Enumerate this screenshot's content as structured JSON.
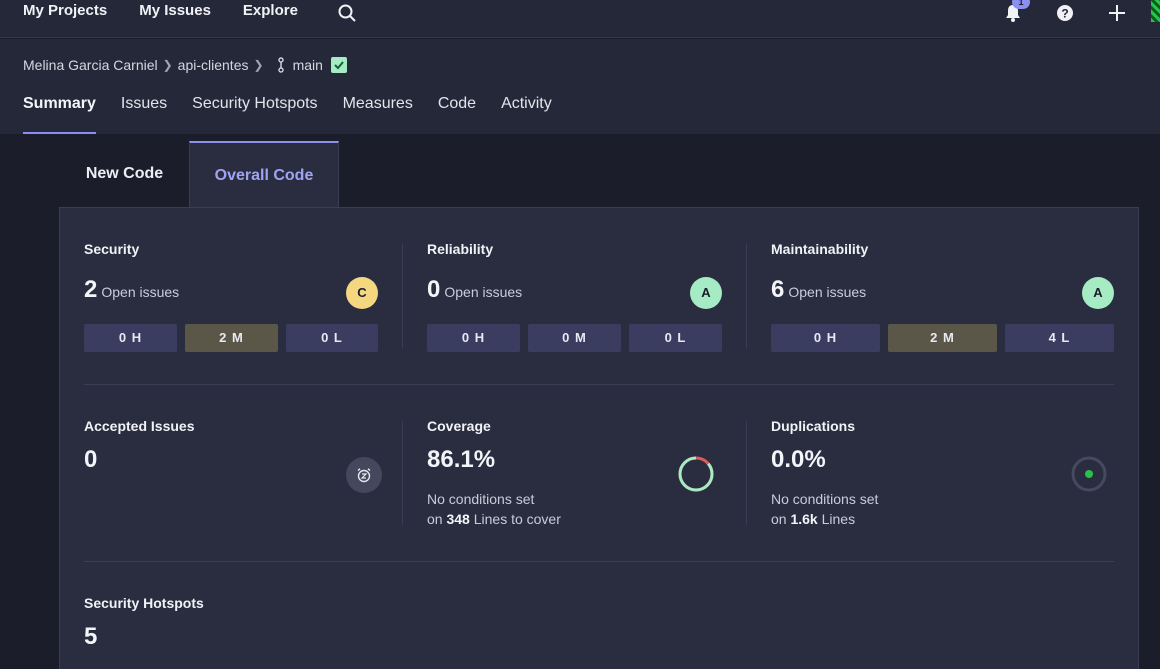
{
  "topnav": {
    "my_projects": "My Projects",
    "my_issues": "My Issues",
    "explore": "Explore",
    "notification_count": "1"
  },
  "breadcrumb": {
    "owner": "Melina Garcia Carniel",
    "project": "api-clientes",
    "branch": "main"
  },
  "tabs": [
    "Summary",
    "Issues",
    "Security Hotspots",
    "Measures",
    "Code",
    "Activity"
  ],
  "code_tabs": {
    "new_code": "New Code",
    "overall_code": "Overall Code"
  },
  "security": {
    "title": "Security",
    "count": "2",
    "open_label": "Open issues",
    "grade": "C",
    "high": "0 H",
    "medium": "2 M",
    "low": "0 L"
  },
  "reliability": {
    "title": "Reliability",
    "count": "0",
    "open_label": "Open issues",
    "grade": "A",
    "high": "0 H",
    "medium": "0 M",
    "low": "0 L"
  },
  "maintainability": {
    "title": "Maintainability",
    "count": "6",
    "open_label": "Open issues",
    "grade": "A",
    "high": "0 H",
    "medium": "2 M",
    "low": "4 L"
  },
  "accepted": {
    "title": "Accepted Issues",
    "value": "0"
  },
  "coverage": {
    "title": "Coverage",
    "value": "86.1%",
    "note": "No conditions set",
    "on": "on",
    "lines": "348",
    "lines_label": "Lines to cover",
    "percent": 86.1
  },
  "duplications": {
    "title": "Duplications",
    "value": "0.0%",
    "note": "No conditions set",
    "on": "on",
    "lines": "1.6k",
    "lines_label": "Lines"
  },
  "hotspots": {
    "title": "Security Hotspots",
    "value": "5"
  },
  "colors": {
    "grade_a": "#a5ecc4",
    "grade_c": "#f5d77f",
    "accent": "#8a8ff0",
    "coverage_good": "#a5ecc4",
    "coverage_bad": "#e05a5a"
  }
}
